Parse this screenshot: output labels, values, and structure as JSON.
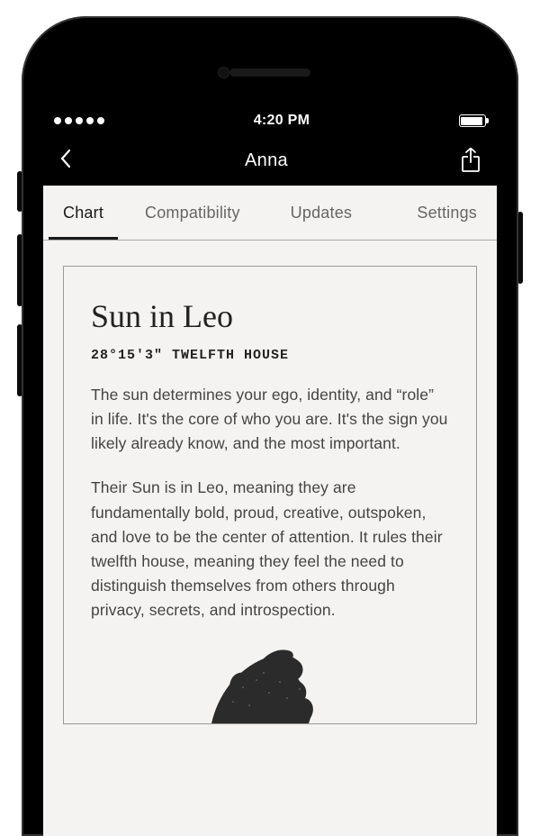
{
  "status": {
    "time": "4:20 PM"
  },
  "nav": {
    "title": "Anna"
  },
  "tabs": [
    {
      "label": "Chart",
      "active": true
    },
    {
      "label": "Compatibility",
      "active": false
    },
    {
      "label": "Updates",
      "active": false
    },
    {
      "label": "Settings",
      "active": false
    }
  ],
  "card": {
    "title": "Sun in Leo",
    "subtitle": "28°15'3\" TWELFTH HOUSE",
    "paragraphs": [
      "The sun determines your ego, identity, and “role” in life. It's the core of who you are. It's the sign you likely already know, and the most important.",
      "Their Sun is in Leo, meaning they are fundamentally bold, proud, creative, outspoken, and love to be the center of attention.  It rules their twelfth house, meaning they feel the need to distinguish themselves from others through privacy, secrets, and introspection."
    ]
  }
}
